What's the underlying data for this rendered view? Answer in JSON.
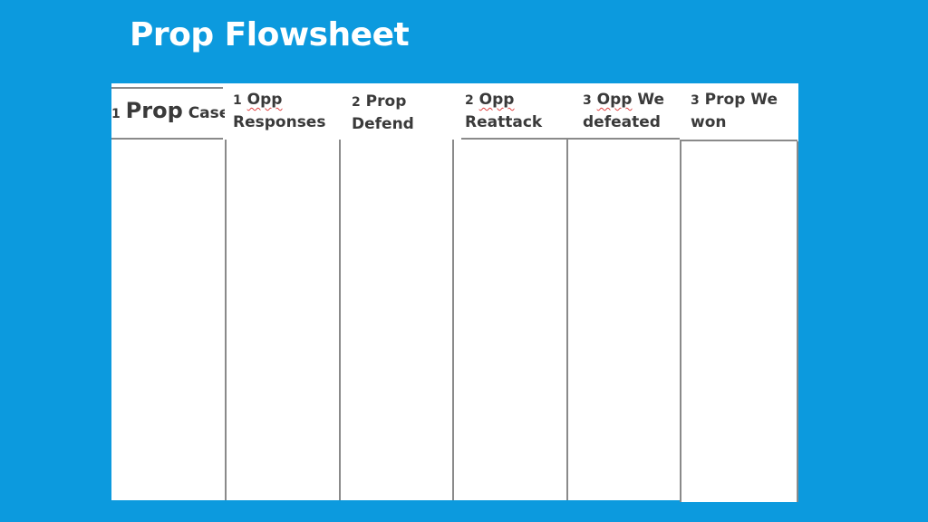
{
  "slide": {
    "title": "Prop Flowsheet",
    "background_color": "#0c9ade"
  },
  "flowsheet": {
    "columns": [
      {
        "number": "1",
        "lead": "Prop",
        "rest": "Case",
        "line2": ""
      },
      {
        "number": "1",
        "lead": "Opp",
        "rest": "",
        "line2": "Responses"
      },
      {
        "number": "2",
        "lead": "Prop",
        "rest": "",
        "line2": "Defend"
      },
      {
        "number": "2",
        "lead": "Opp",
        "rest": "",
        "line2": "Reattack"
      },
      {
        "number": "3",
        "lead": "Opp",
        "rest": "We",
        "line2": "defeated"
      },
      {
        "number": "3",
        "lead": "Prop",
        "rest": "We",
        "line2": "won"
      }
    ]
  }
}
